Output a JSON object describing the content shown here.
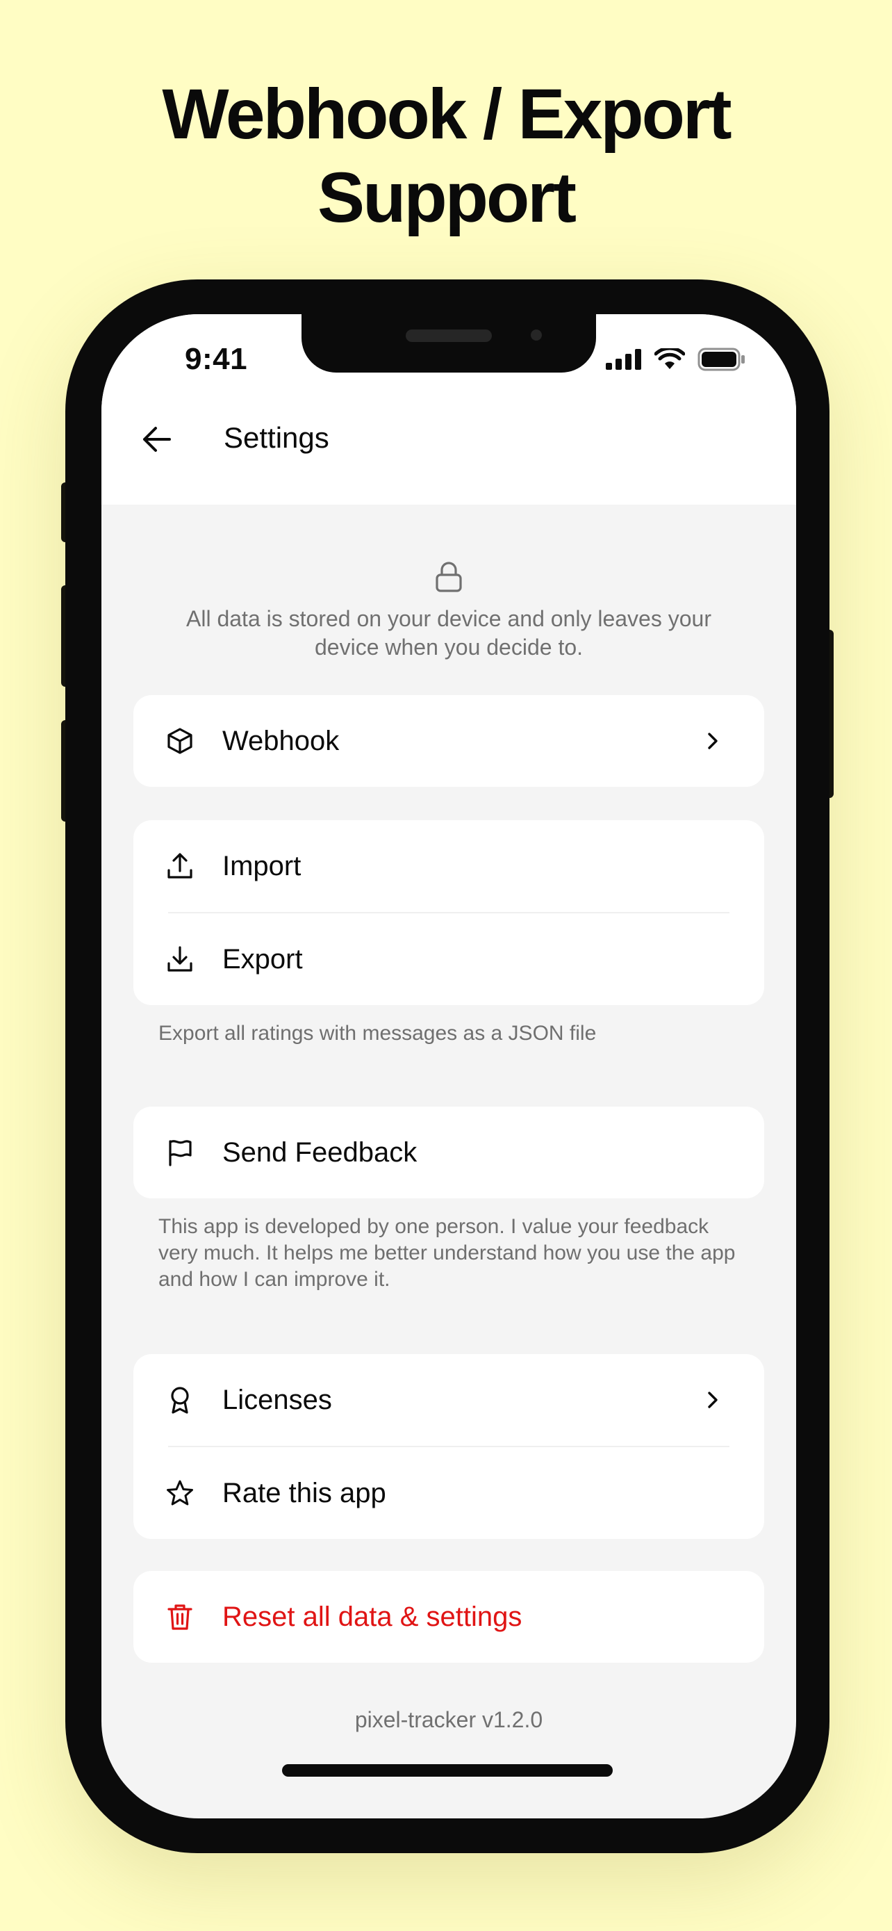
{
  "headline": {
    "line1": "Webhook / Export",
    "line2": "Support"
  },
  "status_bar": {
    "time": "9:41",
    "icons": [
      "cellular-signal-icon",
      "wifi-icon",
      "battery-icon"
    ]
  },
  "header": {
    "back_icon": "arrow-left-icon",
    "title": "Settings"
  },
  "privacy": {
    "icon": "lock-icon",
    "text": "All data is stored on your device and only leaves your device when you decide to."
  },
  "sections": {
    "webhook": {
      "icon": "cube-icon",
      "label": "Webhook",
      "has_chevron": true
    },
    "data": {
      "import": {
        "icon": "upload-icon",
        "label": "Import"
      },
      "export": {
        "icon": "download-icon",
        "label": "Export"
      },
      "note": "Export all ratings with messages as a JSON file"
    },
    "feedback": {
      "icon": "flag-icon",
      "label": "Send Feedback",
      "note": "This app is developed by one person. I value your feedback very much. It helps me better understand how you use the app and how I can improve it."
    },
    "about": {
      "licenses": {
        "icon": "award-icon",
        "label": "Licenses",
        "has_chevron": true
      },
      "rate": {
        "icon": "star-icon",
        "label": "Rate this app"
      }
    },
    "reset": {
      "icon": "trash-icon",
      "label": "Reset all data & settings"
    }
  },
  "version": "pixel-tracker v1.2.0",
  "colors": {
    "background": "#FFFDC4",
    "screen": "#F4F4F4",
    "card": "#FFFFFF",
    "danger": "#E01414",
    "muted_text": "#707070",
    "frame": "#0B0B0B"
  }
}
